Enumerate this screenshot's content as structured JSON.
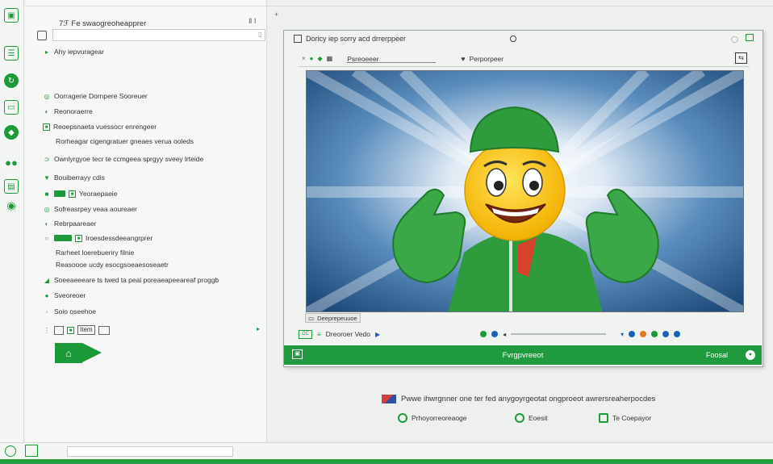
{
  "colors": {
    "accent": "#1f9a3c",
    "accent_dark": "#168232",
    "link_blue": "#1c63b8"
  },
  "rail": {
    "icons": [
      "tab-icon",
      "layers-icon",
      "refresh-icon",
      "window-icon",
      "badge-icon",
      "group-icon",
      "card-icon",
      "chat-icon"
    ]
  },
  "sidebar": {
    "title": "7ℱ Fe swaogreoheapprer",
    "close_label": "Ⅱ Ⅰ",
    "search": {
      "value": "",
      "placeholder": ""
    },
    "items": [
      {
        "label": "Ahy iepvuragear"
      },
      {
        "label": "Oorragerie Dornpere Sooreuer"
      },
      {
        "label": "Reonoraerre"
      },
      {
        "label": "Reoepsnaeta vuessocr enrengeer"
      },
      {
        "label": "Rorheagar cigengratuer gneaes verua ooleds"
      },
      {
        "label": "Ownlyrgyoe tecr te ccmgeea sprgyy sveey lrteide"
      },
      {
        "label": "Bouiberrayy cdis"
      },
      {
        "label": "Yeoraepaeie"
      },
      {
        "label": "Sofreasrpey veaa aoureaer"
      },
      {
        "label": "Rebrpaareaer"
      },
      {
        "label": "Iroesdessdeeangrprer"
      },
      {
        "label": "Rarheet loerebueriry filnie"
      },
      {
        "label": "Reasoooe ucdy esocgsoeaesoseaetr"
      },
      {
        "label": "Soeeaeeeare ts twed ta peai poreaeapeeareaf proggb"
      },
      {
        "label": "Sveoreoer"
      },
      {
        "label": "Soio oseehoe"
      },
      {
        "label": "Item"
      }
    ]
  },
  "player": {
    "title": "Doricy iep sorry acd drrerppeer",
    "toolbar": {
      "field_value": "Psreoeeer",
      "favorite_label": "Perporpeer"
    },
    "video_label": "Deeprepeuuoe",
    "controls": {
      "label": "Dreoroer Vedo"
    },
    "footer_center": "Fvrgpvreeot",
    "footer_right": "Foosal"
  },
  "caption": {
    "text": "Pwwe ihwrgnner one ter fed anygoyrgeotat ongproeot awrersreaherpocdes",
    "links": [
      {
        "label": "Prhoyorreoreaoge"
      },
      {
        "label": "Eoesit"
      },
      {
        "label": "Te Coepayor"
      }
    ]
  }
}
